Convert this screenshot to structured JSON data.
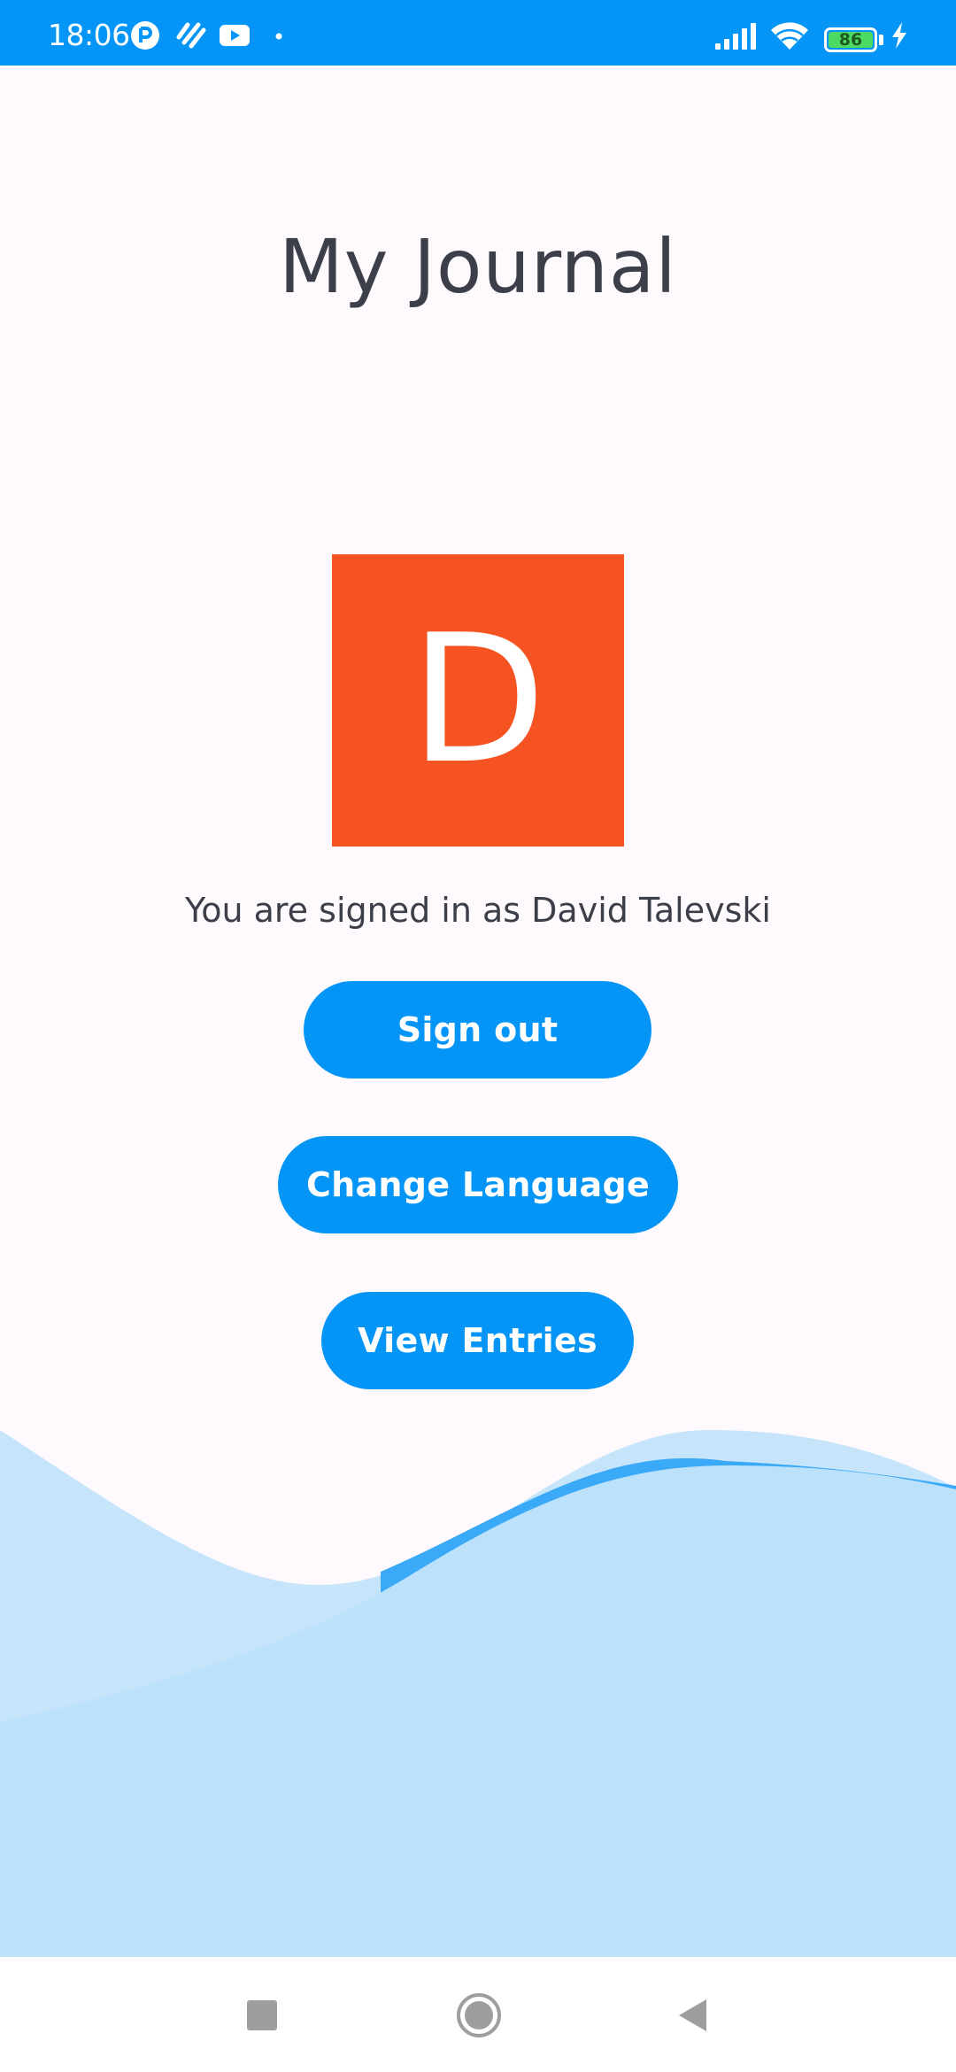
{
  "status_bar": {
    "time": "18:06",
    "battery_level": "86",
    "notification_icons": [
      "app-icon",
      "heart-icon",
      "youtube-icon",
      "dot-icon"
    ],
    "system_icons": [
      "signal-icon",
      "wifi-icon",
      "battery-icon",
      "charging-icon"
    ],
    "color": "#0495f7"
  },
  "app": {
    "title": "My Journal",
    "avatar_letter": "D",
    "avatar_color": "#f65322",
    "signed_in_text": "You are signed in as David Talevski"
  },
  "buttons": {
    "sign_out": "Sign out",
    "change_language": "Change Language",
    "view_entries": "View Entries",
    "color": "#0495f7"
  },
  "nav_bar": {
    "icons": [
      "recents-icon",
      "home-icon",
      "back-icon"
    ]
  }
}
